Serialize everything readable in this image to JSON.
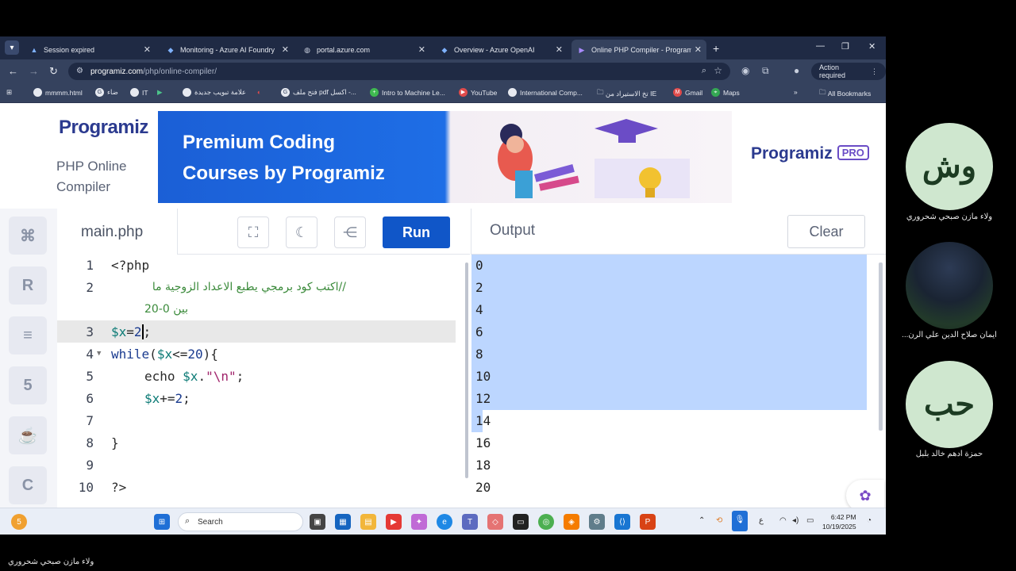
{
  "browser": {
    "tabs": [
      {
        "title": "Session expired",
        "active": false
      },
      {
        "title": "Monitoring - Azure AI Foundry",
        "active": false
      },
      {
        "title": "portal.azure.com",
        "active": false
      },
      {
        "title": "Overview - Azure OpenAI",
        "active": false
      },
      {
        "title": "Online PHP Compiler - Program",
        "active": true
      }
    ],
    "url_host": "programiz.com",
    "url_path": "/php/online-compiler/",
    "action_required": "Action required",
    "bookmarks": [
      "mmmm.html",
      "ضاء",
      "IT",
      "علامة تبويب جديدة",
      "فتح ملف pdf اكسل -...",
      "Intro to Machine Le...",
      "YouTube",
      "International Comp...",
      "تخ الاستيراد من IE",
      "Gmail",
      "Maps",
      "All Bookmarks"
    ]
  },
  "page": {
    "logo": "Programiz",
    "subtitle_line1": "PHP Online",
    "subtitle_line2": "Compiler",
    "banner_line1": "Premium Coding",
    "banner_line2": "Courses by Programiz",
    "pro_logo": "Programiz",
    "pro_badge": "PRO"
  },
  "editor": {
    "filename": "main.php",
    "run_label": "Run",
    "line_numbers": [
      "1",
      "2",
      "3",
      "4",
      "5",
      "6",
      "7",
      "8",
      "9",
      "10"
    ],
    "code": {
      "l1": "<?php",
      "l2": "//اكتب كود برمجي يطبع الاعداد الزوجية ما",
      "l2b": "بين 0-20",
      "l3_var": "$x",
      "l3_op": "=",
      "l3_num": "2",
      "l3_end": ";",
      "l4_kw": "while",
      "l4_open": "(",
      "l4_var": "$x",
      "l4_op": "<=",
      "l4_num": "20",
      "l4_close": "){",
      "l5_pre": "echo ",
      "l5_var": "$x",
      "l5_dot": ".",
      "l5_str": "\"\\n\"",
      "l5_end": ";",
      "l6_var": "$x",
      "l6_op": "+=",
      "l6_num": "2",
      "l6_end": ";",
      "l8": "}",
      "l10": "?>"
    }
  },
  "output": {
    "title": "Output",
    "clear_label": "Clear",
    "lines": [
      "0",
      "2",
      "4",
      "6",
      "8",
      "10",
      "12",
      "14",
      "16",
      "18",
      "20"
    ]
  },
  "taskbar": {
    "search_placeholder": "Search",
    "time": "6:42 PM",
    "date": "10/19/2025",
    "lang": "ع"
  },
  "participants": [
    {
      "initials": "وش",
      "name": "ولاء مازن صبحي شحروري"
    },
    {
      "initials": "",
      "name": "...ايمان صلاح الدين علي الرن"
    },
    {
      "initials": "حب",
      "name": "حمزة ادهم خالد بلبل"
    }
  ],
  "caption": "ولاء مازن صبحي شحروري"
}
